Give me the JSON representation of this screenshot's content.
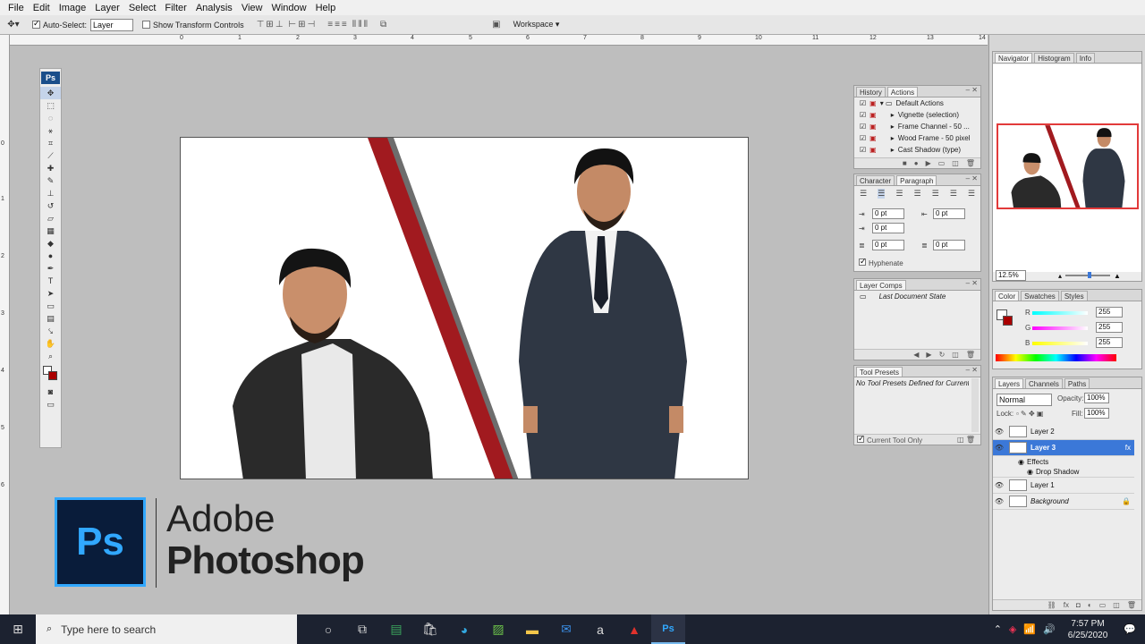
{
  "menu": [
    "File",
    "Edit",
    "Image",
    "Layer",
    "Select",
    "Filter",
    "Analysis",
    "View",
    "Window",
    "Help"
  ],
  "options": {
    "auto_select_label": "Auto-Select:",
    "auto_select_value": "Layer",
    "show_transform_label": "Show Transform Controls",
    "workspace_label": "Workspace ▾"
  },
  "ruler_top": [
    "0",
    "1",
    "2",
    "3",
    "4",
    "5",
    "6",
    "7",
    "8",
    "9",
    "10",
    "11",
    "12",
    "13",
    "14"
  ],
  "ruler_left": [
    "0",
    "1",
    "2",
    "3",
    "4",
    "5",
    "6"
  ],
  "tools": [
    "move",
    "marquee",
    "lasso",
    "magic-wand",
    "crop",
    "slice",
    "healing",
    "brush",
    "stamp",
    "history-brush",
    "eraser",
    "gradient",
    "blur",
    "dodge",
    "pen",
    "type",
    "path-select",
    "shape",
    "notes",
    "eyedropper",
    "hand",
    "zoom"
  ],
  "logo": {
    "ps": "Ps",
    "adobe": "Adobe",
    "photoshop": "Photoshop"
  },
  "history_actions": {
    "tabs": [
      "History",
      "Actions"
    ],
    "items": [
      "Default Actions",
      "Vignette (selection)",
      "Frame Channel - 50 ...",
      "Wood Frame - 50 pixel",
      "Cast Shadow (type)"
    ]
  },
  "char_para": {
    "tabs": [
      "Character",
      "Paragraph"
    ],
    "fields": [
      "0 pt",
      "0 pt",
      "0 pt",
      "0 pt",
      "0 pt"
    ],
    "hyphenate": "Hyphenate"
  },
  "layer_comps": {
    "tab": "Layer Comps",
    "item": "Last Document State"
  },
  "tool_presets": {
    "tab": "Tool Presets",
    "message": "No Tool Presets Defined for Current Tool",
    "current_only": "Current Tool Only"
  },
  "navigator": {
    "tabs": [
      "Navigator",
      "Histogram",
      "Info"
    ],
    "zoom": "12.5%"
  },
  "color": {
    "tabs": [
      "Color",
      "Swatches",
      "Styles"
    ],
    "channels": [
      {
        "label": "R",
        "value": "255"
      },
      {
        "label": "G",
        "value": "255"
      },
      {
        "label": "B",
        "value": "255"
      }
    ]
  },
  "layers": {
    "tabs": [
      "Layers",
      "Channels",
      "Paths"
    ],
    "blend": "Normal",
    "opacity_label": "Opacity:",
    "opacity": "100%",
    "lock_label": "Lock:",
    "fill_label": "Fill:",
    "fill": "100%",
    "rows": [
      "Layer 2",
      "Layer 3",
      "Effects",
      "Drop Shadow",
      "Layer 1",
      "Background"
    ]
  },
  "taskbar": {
    "search_placeholder": "Type here to search",
    "time": "7:57 PM",
    "date": "6/25/2020"
  },
  "colors": {
    "accent": "#31a8ff",
    "selection": "#3b78d8",
    "stripe": "#a11a1f"
  }
}
